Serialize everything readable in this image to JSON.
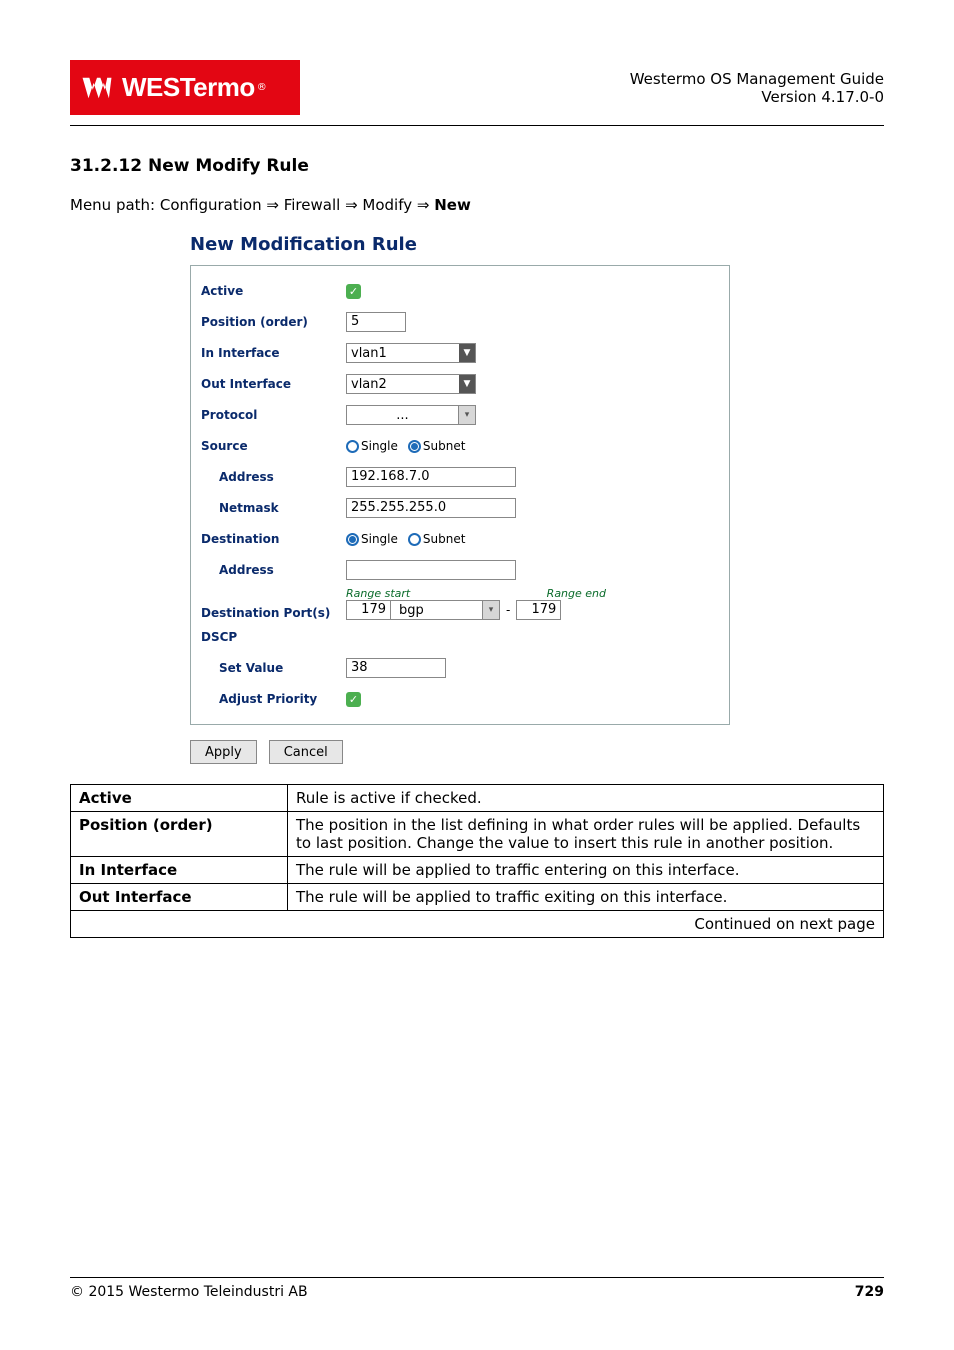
{
  "header": {
    "logo_text": "WESTermo",
    "title_line1": "Westermo OS Management Guide",
    "title_line2": "Version 4.17.0-0"
  },
  "section": {
    "number_title": "31.2.12   New Modify Rule",
    "menu_path_prefix": "Menu path: Configuration ",
    "arrow": "⇒",
    "mp_firewall": " Firewall ",
    "mp_modify": " Modify ",
    "mp_new": "New"
  },
  "form": {
    "title": "New Modification Rule",
    "labels": {
      "active": "Active",
      "position": "Position (order)",
      "in_interface": "In Interface",
      "out_interface": "Out Interface",
      "protocol": "Protocol",
      "source": "Source",
      "source_address": "Address",
      "source_netmask": "Netmask",
      "destination": "Destination",
      "dest_address": "Address",
      "dest_ports": "Destination Port(s)",
      "dscp": "DSCP",
      "set_value": "Set Value",
      "adjust_priority": "Adjust Priority"
    },
    "values": {
      "position": "5",
      "in_interface": "vlan1",
      "out_interface": "vlan2",
      "protocol": "...",
      "source_address": "192.168.7.0",
      "source_netmask": "255.255.255.0",
      "dest_address": "",
      "port_start": "179",
      "port_code": "bgp",
      "port_end": "179",
      "set_value": "38"
    },
    "source_radio": {
      "single": false,
      "subnet": true
    },
    "dest_radio": {
      "single": true,
      "subnet": false
    },
    "radio_labels": {
      "single": "Single",
      "subnet": "Subnet"
    },
    "port_hints": {
      "start": "Range start",
      "end": "Range end"
    },
    "buttons": {
      "apply": "Apply",
      "cancel": "Cancel"
    }
  },
  "table": {
    "rows": [
      {
        "k": "Active",
        "v": "Rule is active if checked."
      },
      {
        "k": "Position (order)",
        "v": "The position in the list defining in what order rules will be applied.  Defaults to last position.  Change the value to insert this rule in another position."
      },
      {
        "k": "In Interface",
        "v": "The rule will be applied to traffic entering on this interface."
      },
      {
        "k": "Out Interface",
        "v": "The rule will be applied to traffic exiting on this interface."
      }
    ],
    "continued": "Continued on next page"
  },
  "footer": {
    "copyright": "© 2015 Westermo Teleindustri AB",
    "page": "729"
  }
}
